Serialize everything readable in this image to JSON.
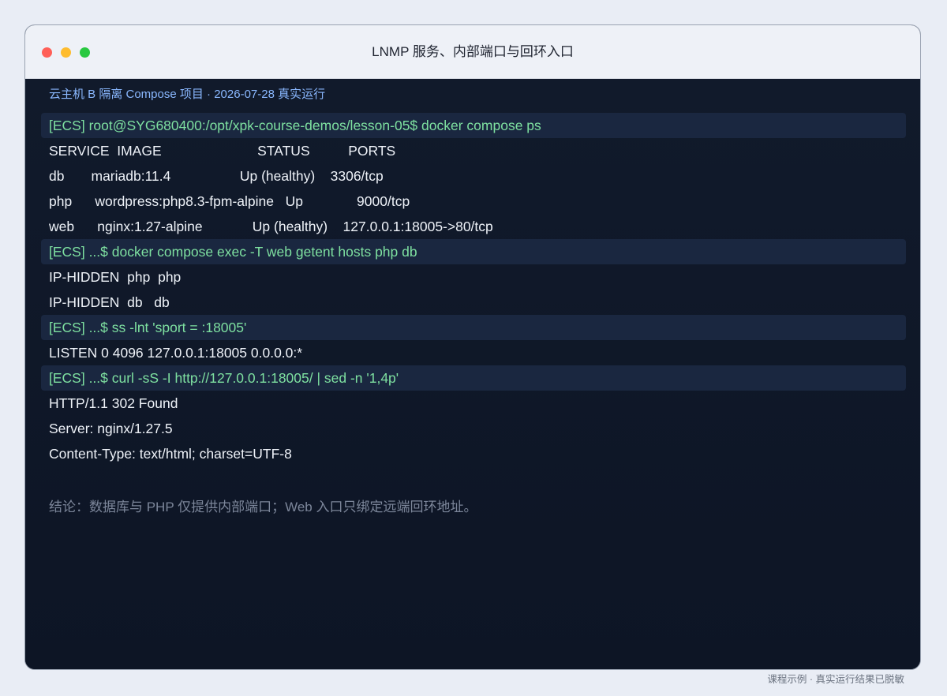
{
  "window": {
    "title": "LNMP 服务、内部端口与回环入口"
  },
  "terminal": {
    "subtitle": "云主机 B 隔离 Compose 项目 · 2026-07-28 真实运行",
    "lines": [
      {
        "type": "command",
        "text": "[ECS] root@SYG680400:/opt/xpk-course-demos/lesson-05$ docker compose ps"
      },
      {
        "type": "output",
        "text": "SERVICE  IMAGE                         STATUS          PORTS"
      },
      {
        "type": "output",
        "text": "db       mariadb:11.4                  Up (healthy)    3306/tcp"
      },
      {
        "type": "output",
        "text": "php      wordpress:php8.3-fpm-alpine   Up              9000/tcp"
      },
      {
        "type": "output",
        "text": "web      nginx:1.27-alpine             Up (healthy)    127.0.0.1:18005->80/tcp"
      },
      {
        "type": "command",
        "text": "[ECS] ...$ docker compose exec -T web getent hosts php db"
      },
      {
        "type": "output",
        "text": "IP-HIDDEN  php  php"
      },
      {
        "type": "output",
        "text": "IP-HIDDEN  db   db"
      },
      {
        "type": "command",
        "text": "[ECS] ...$ ss -lnt 'sport = :18005'"
      },
      {
        "type": "output",
        "text": "LISTEN 0 4096 127.0.0.1:18005 0.0.0.0:*"
      },
      {
        "type": "command",
        "text": "[ECS] ...$ curl -sS -I http://127.0.0.1:18005/ | sed -n '1,4p'"
      },
      {
        "type": "output",
        "text": "HTTP/1.1 302 Found"
      },
      {
        "type": "output",
        "text": "Server: nginx/1.27.5"
      },
      {
        "type": "output",
        "text": "Content-Type: text/html; charset=UTF-8"
      }
    ],
    "conclusion": "结论：数据库与 PHP 仅提供内部端口；Web 入口只绑定远端回环地址。"
  },
  "footer": {
    "caption": "课程示例 · 真实运行结果已脱敏"
  },
  "colors": {
    "command_text": "#7ee0a0",
    "output_text": "#eef2f8",
    "subtitle": "#8ab8ff",
    "background": "#0e1626"
  }
}
